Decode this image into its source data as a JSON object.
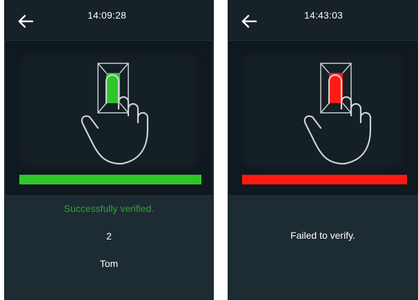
{
  "success_screen": {
    "time": "14:09:28",
    "indicator_color": "#2fc62a",
    "verification_progress": 1.0,
    "message": "Successfully verified.",
    "message_color": "#2fa52f",
    "user_id": "2",
    "user_name": "Tom"
  },
  "failure_screen": {
    "time": "14:43:03",
    "indicator_color": "#ff1a12",
    "verification_progress": 1.0,
    "message": "Failed to verify."
  },
  "icons": {
    "back": "left-arrow",
    "fingerprint": "finger-on-sensor"
  }
}
